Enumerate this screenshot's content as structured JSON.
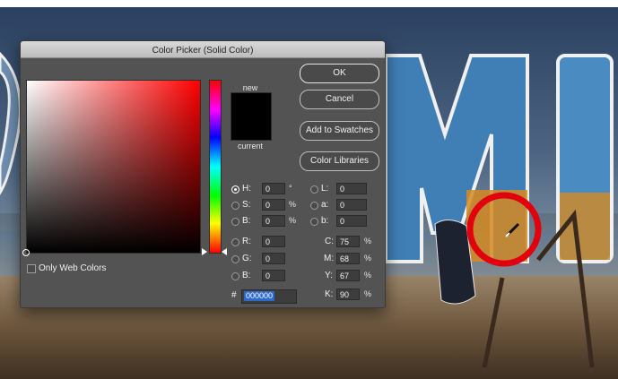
{
  "dialog": {
    "title": "Color Picker (Solid Color)",
    "new_label": "new",
    "current_label": "current",
    "buttons": {
      "ok": "OK",
      "cancel": "Cancel",
      "add_swatches": "Add to Swatches",
      "color_libraries": "Color Libraries"
    },
    "only_web_colors": "Only Web Colors",
    "hsb": {
      "h_label": "H:",
      "h_value": "0",
      "h_unit": "°",
      "s_label": "S:",
      "s_value": "0",
      "s_unit": "%",
      "b_label": "B:",
      "b_value": "0",
      "b_unit": "%"
    },
    "rgb": {
      "r_label": "R:",
      "r_value": "0",
      "g_label": "G:",
      "g_value": "0",
      "b_label": "B:",
      "b_value": "0"
    },
    "lab": {
      "l_label": "L:",
      "l_value": "0",
      "a_label": "a:",
      "a_value": "0",
      "b_label": "b:",
      "b_value": "0"
    },
    "cmyk": {
      "c_label": "C:",
      "c_value": "75",
      "c_unit": "%",
      "m_label": "M:",
      "m_value": "68",
      "m_unit": "%",
      "y_label": "Y:",
      "y_value": "67",
      "y_unit": "%",
      "k_label": "K:",
      "k_value": "90",
      "k_unit": "%"
    },
    "hex_label": "#",
    "hex_value": "000000",
    "colors": {
      "new_color": "#000000",
      "current_color": "#000000",
      "field_hue": "#ff0000",
      "highlight": "#2c69c9"
    }
  },
  "canvas": {
    "letters_visible": "MI",
    "annotation_circle_color": "#e0000e",
    "tool": "eyedropper-icon"
  }
}
